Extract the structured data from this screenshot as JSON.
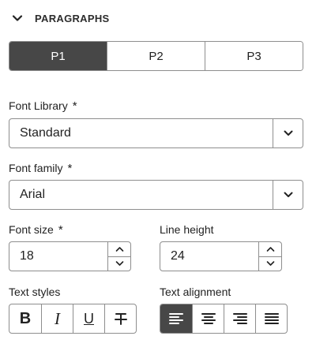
{
  "section": {
    "title": "PARAGRAPHS",
    "icon": "chevron-down-icon"
  },
  "tabs": [
    {
      "label": "P1",
      "selected": true
    },
    {
      "label": "P2",
      "selected": false
    },
    {
      "label": "P3",
      "selected": false
    }
  ],
  "font_library": {
    "label": "Font Library",
    "required_mark": "*",
    "value": "Standard"
  },
  "font_family": {
    "label": "Font family",
    "required_mark": "*",
    "value": "Arial"
  },
  "font_size": {
    "label": "Font size",
    "required_mark": "*",
    "value": "18"
  },
  "line_height": {
    "label": "Line height",
    "value": "24"
  },
  "text_styles": {
    "label": "Text styles",
    "buttons": [
      {
        "glyph": "B",
        "icon": "bold-icon"
      },
      {
        "glyph": "I",
        "icon": "italic-icon"
      },
      {
        "glyph": "U",
        "icon": "underline-icon"
      },
      {
        "icon": "strikethrough-icon"
      }
    ]
  },
  "text_alignment": {
    "label": "Text alignment",
    "selected": "left",
    "buttons": [
      {
        "icon": "align-left-icon",
        "selected": true
      },
      {
        "icon": "align-center-icon",
        "selected": false
      },
      {
        "icon": "align-right-icon",
        "selected": false
      },
      {
        "icon": "align-justify-icon",
        "selected": false
      }
    ]
  },
  "colors": {
    "selected_fill": "#474747",
    "border": "#8e8e8e",
    "text": "#222222"
  }
}
